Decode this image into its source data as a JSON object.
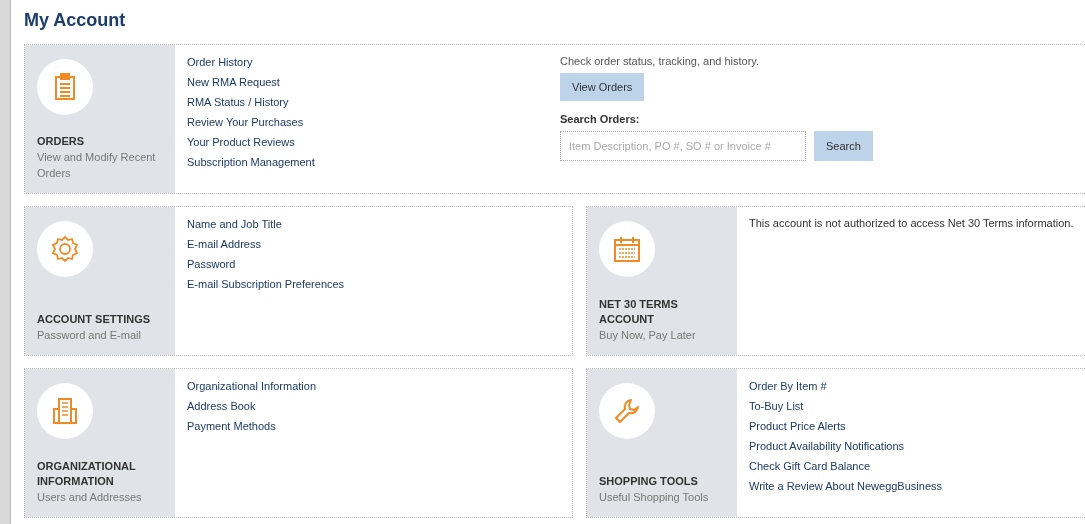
{
  "page_title": "My Account",
  "cards": [
    {
      "kind": "clipboard",
      "title": "ORDERS",
      "subtitle": "View and Modify Recent Orders",
      "links": [
        "Order History",
        "New RMA Request",
        "RMA Status / History",
        "Review Your Purchases",
        "Your Product Reviews",
        "Subscription Management"
      ],
      "extra": {
        "note": "Check order status, tracking, and history.",
        "button": "View Orders",
        "search_label": "Search Orders:",
        "search": {
          "placeholder": "Item Description, PO #, SO # or Invoice #"
        },
        "search_button": "Search"
      }
    },
    {
      "kind": "gear",
      "title": "ACCOUNT SETTINGS",
      "subtitle": "Password and E-mail",
      "links": [
        "Name and Job Title",
        "E-mail Address",
        "Password",
        "E-mail Subscription Preferences"
      ]
    },
    {
      "kind": "calendar",
      "title": "NET 30 TERMS ACCOUNT",
      "subtitle": "Buy Now, Pay Later",
      "message": "This account is not authorized to access Net 30 Terms information."
    },
    {
      "kind": "building",
      "title": "ORGANIZATIONAL INFORMATION",
      "subtitle": "Users and Addresses",
      "links": [
        "Organizational Information",
        "Address Book",
        "Payment Methods"
      ]
    },
    {
      "kind": "wrench",
      "title": "SHOPPING TOOLS",
      "subtitle": "Useful Shopping Tools",
      "links": [
        "Order By Item #",
        "To-Buy List",
        "Product Price Alerts",
        "Product Availability Notifications",
        "Check Gift Card Balance",
        "Write a Review About NeweggBusiness"
      ]
    }
  ]
}
